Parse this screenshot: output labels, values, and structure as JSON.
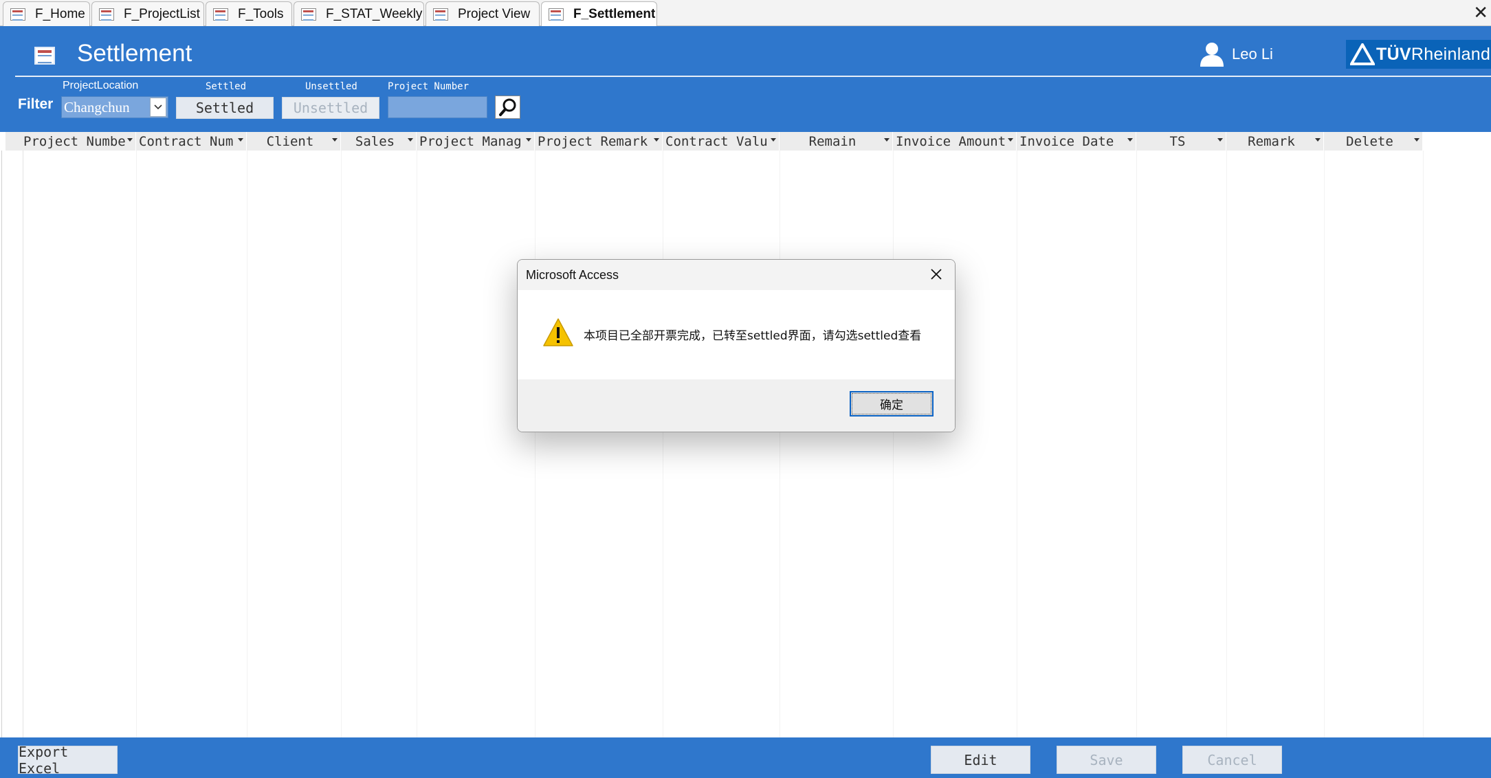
{
  "tabs": [
    {
      "label": "F_Home",
      "active": false
    },
    {
      "label": "F_ProjectList",
      "active": false
    },
    {
      "label": "F_Tools",
      "active": false
    },
    {
      "label": "F_STAT_Weekly",
      "active": false
    },
    {
      "label": "Project View",
      "active": false
    },
    {
      "label": "F_Settlement",
      "active": true
    }
  ],
  "header": {
    "title": "Settlement",
    "user_name": "Leo Li",
    "logo_bold": "TÜV",
    "logo_rest": "Rheinland"
  },
  "filter": {
    "label": "Filter",
    "location_label": "ProjectLocation",
    "location_value": "Changchun",
    "settled_label": "Settled",
    "settled_button": "Settled",
    "unsettled_label": "Unsettled",
    "unsettled_button": "Unsettled",
    "project_number_label": "Project Number",
    "project_number_value": ""
  },
  "columns": [
    "Project Numbe",
    "Contract Num",
    "Client",
    "Sales",
    "Project Manag",
    "Project Remark",
    "Contract Valu",
    "Remain",
    "Invoice Amount",
    "Invoice Date",
    "TS",
    "Remark",
    "Delete"
  ],
  "footer": {
    "export_button": "Export Excel",
    "edit_button": "Edit",
    "save_button": "Save",
    "cancel_button": "Cancel"
  },
  "dialog": {
    "title": "Microsoft Access",
    "message": "本项目已全部开票完成，已转至settled界面，请勾选settled查看",
    "ok_button": "确定"
  },
  "colors": {
    "header_blue": "#2f77cc",
    "logo_blue": "#0a63b8",
    "dialog_focus": "#0a62c4"
  }
}
